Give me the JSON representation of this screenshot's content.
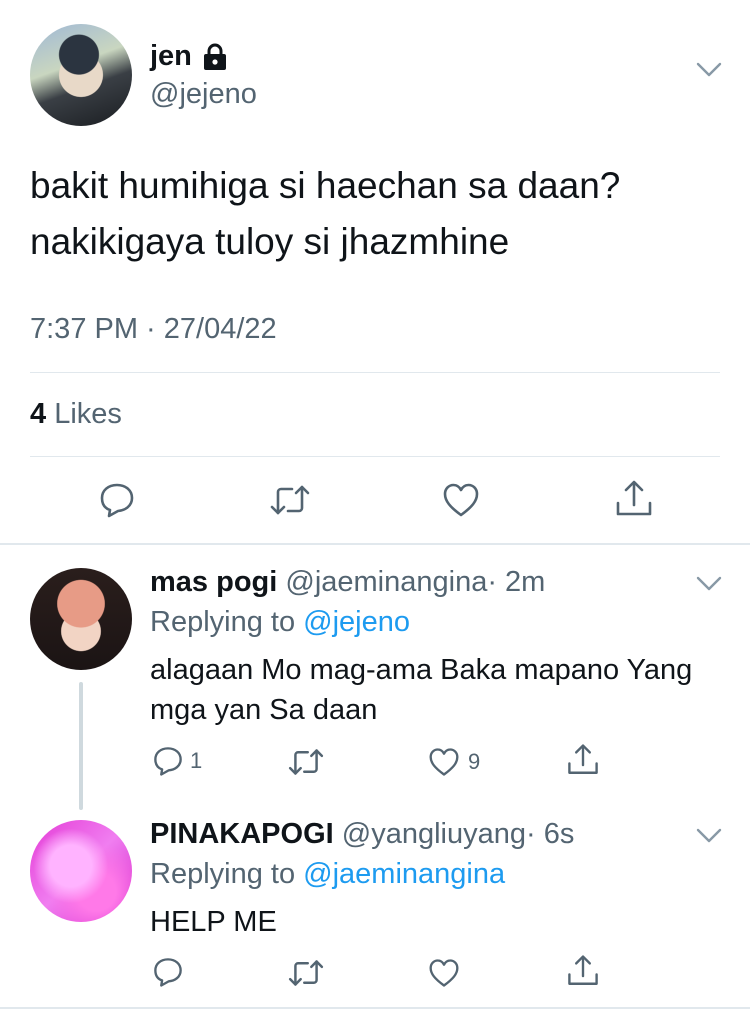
{
  "tweet": {
    "author_name": "jen",
    "author_handle": "@jejeno",
    "text_line1": "bakit humihiga si haechan sa daan?",
    "text_line2": "nakikigaya tuloy si jhazmhine",
    "timestamp": "7:37 PM · 27/04/22",
    "likes_count": "4",
    "likes_label": "Likes",
    "icons": [
      "reply-icon",
      "retweet-icon",
      "like-icon",
      "share-icon"
    ]
  },
  "replies": [
    {
      "author_name": "mas pogi",
      "author_handle": "@jaeminangina",
      "time": "· 2m",
      "replying_label": "Replying to",
      "replying_to": "@jejeno",
      "text_line1": "alagaan Mo mag-ama Baka mapano Yang",
      "text_line2": "mga yan Sa daan",
      "reply_count": "1",
      "like_count": "9"
    },
    {
      "author_name": "PINAKAPOGI",
      "author_handle": "@yangliuyang",
      "time": "· 6s",
      "replying_label": "Replying to",
      "replying_to": "@jaeminangina",
      "text_line1": "HELP ME"
    }
  ],
  "colors": {
    "accent": "#1d9bf0",
    "secondary_text": "#536471",
    "divider": "#e1e8ed"
  }
}
